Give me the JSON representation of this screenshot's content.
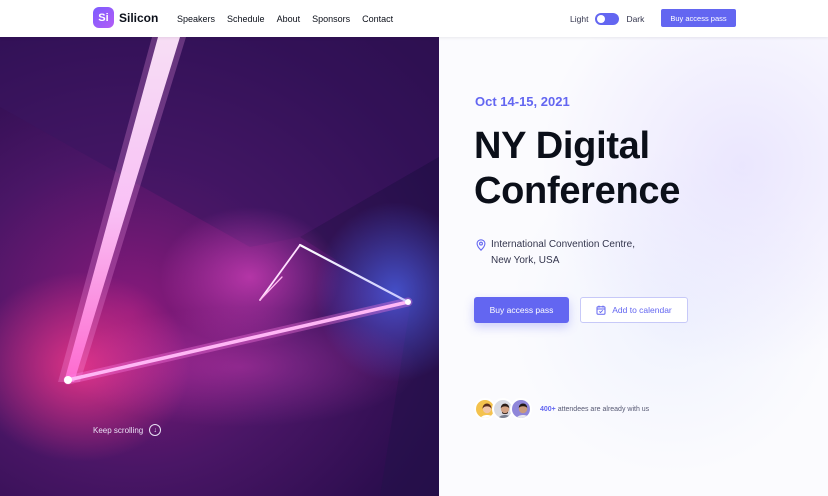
{
  "header": {
    "logo_mark": "Si",
    "brand": "Silicon",
    "nav": [
      "Speakers",
      "Schedule",
      "About",
      "Sponsors",
      "Contact"
    ],
    "theme_light": "Light",
    "theme_dark": "Dark",
    "cta": "Buy access pass"
  },
  "hero": {
    "keep_scrolling": "Keep scrolling",
    "date": "Oct 14-15, 2021",
    "title_line1": "NY Digital",
    "title_line2": "Conference",
    "location_line1": "International Convention Centre,",
    "location_line2": "New York, USA",
    "primary_button": "Buy access pass",
    "secondary_button": "Add to calendar",
    "attendees_count": "400+",
    "attendees_text": "attendees are already with us"
  },
  "colors": {
    "accent": "#6366f1",
    "text": "#0b0f19"
  },
  "icons": [
    "logo-icon",
    "toggle-switch",
    "arrow-down-circle-icon",
    "map-pin-icon",
    "calendar-icon"
  ]
}
